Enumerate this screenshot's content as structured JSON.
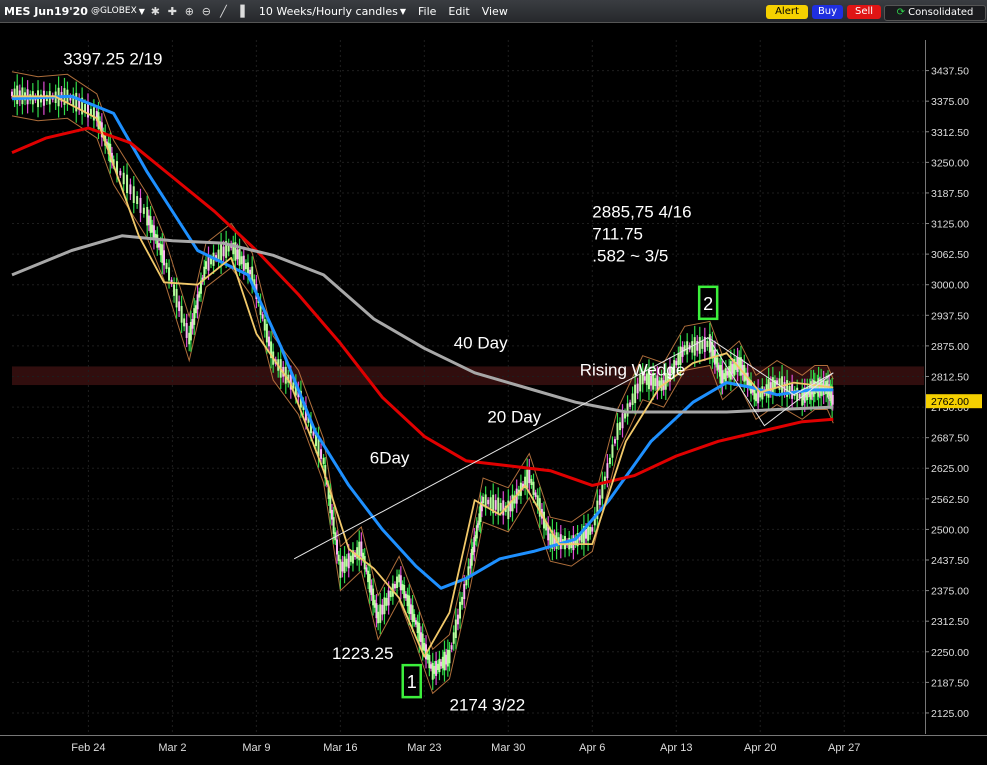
{
  "toolbar": {
    "symbol": "MES Jun19'20",
    "exchange": "@GLOBEX",
    "timeframe": "10 Weeks/Hourly candles",
    "menu_file": "File",
    "menu_edit": "Edit",
    "menu_view": "View",
    "alert": "Alert",
    "buy": "Buy",
    "sell": "Sell",
    "consolidated": "Consolidated"
  },
  "chart_data": {
    "type": "line",
    "yticks": [
      3437.5,
      3375,
      3312.5,
      3250,
      3187.5,
      3125,
      3062.5,
      3000,
      2937.5,
      2875,
      2812.5,
      2750,
      2687.5,
      2625,
      2562.5,
      2500,
      2437.5,
      2375,
      2312.5,
      2250,
      2187.5,
      2125
    ],
    "ytick_labels": [
      "3437.50",
      "3375.00",
      "3312.50",
      "3250.00",
      "3187.50",
      "3125.00",
      "3062.50",
      "3000.00",
      "2937.50",
      "2875.00",
      "2812.50",
      "2750.00",
      "2687.50",
      "2625.00",
      "2562.50",
      "2500.00",
      "2437.50",
      "2375.00",
      "2312.50",
      "2250.00",
      "2187.50",
      "2125.00"
    ],
    "ylim": [
      2082,
      3500
    ],
    "xlabels": [
      "Feb 24",
      "Mar 2",
      "Mar 9",
      "Mar 16",
      "Mar 23",
      "Mar 30",
      "Apr 6",
      "Apr 13",
      "Apr 20",
      "Apr 27"
    ],
    "xpos": [
      1,
      2,
      3,
      4,
      5,
      6,
      7,
      8,
      9,
      10
    ],
    "xlim": [
      0.09,
      10.95
    ],
    "last_price": "2762.00",
    "zone": [
      2795,
      2833
    ],
    "price": {
      "x": [
        0.09,
        0.4,
        0.75,
        1.1,
        1.3,
        1.7,
        1.9,
        2.2,
        2.4,
        2.7,
        2.95,
        3.2,
        3.5,
        3.8,
        4.0,
        4.25,
        4.45,
        4.7,
        4.9,
        5.1,
        5.3,
        5.55,
        5.7,
        6.0,
        6.25,
        6.5,
        6.75,
        7.0,
        7.3,
        7.6,
        7.85,
        8.1,
        8.4,
        8.55,
        8.75,
        8.95,
        9.2,
        9.5,
        9.65,
        9.8,
        9.87
      ],
      "y": [
        3390,
        3380,
        3385,
        3345,
        3250,
        3140,
        3055,
        2890,
        3040,
        3080,
        3020,
        2850,
        2780,
        2640,
        2420,
        2460,
        2320,
        2400,
        2310,
        2210,
        2240,
        2430,
        2560,
        2540,
        2610,
        2480,
        2470,
        2500,
        2700,
        2810,
        2795,
        2870,
        2880,
        2810,
        2840,
        2770,
        2800,
        2770,
        2790,
        2790,
        2762
      ]
    },
    "series": [
      {
        "name": "6Day",
        "color": "#1e90ff",
        "x": [
          0.09,
          0.8,
          1.3,
          1.7,
          2.3,
          2.9,
          3.3,
          3.7,
          4.1,
          4.5,
          4.9,
          5.2,
          5.5,
          5.9,
          6.3,
          6.8,
          7.2,
          7.7,
          8.2,
          8.6,
          8.9,
          9.2,
          9.6,
          9.87
        ],
        "y": [
          3380,
          3385,
          3350,
          3230,
          3070,
          3020,
          2870,
          2700,
          2590,
          2500,
          2425,
          2380,
          2400,
          2440,
          2455,
          2480,
          2560,
          2680,
          2760,
          2800,
          2790,
          2775,
          2785,
          2785
        ]
      },
      {
        "name": "20 Day",
        "color": "#e00000",
        "x": [
          0.09,
          0.5,
          1.0,
          1.5,
          2.0,
          2.5,
          3.0,
          3.5,
          4.0,
          4.5,
          5.0,
          5.5,
          6.0,
          6.5,
          7.0,
          7.5,
          8.0,
          8.5,
          9.0,
          9.5,
          9.87
        ],
        "y": [
          3270,
          3300,
          3320,
          3290,
          3220,
          3150,
          3070,
          2980,
          2880,
          2770,
          2690,
          2640,
          2630,
          2620,
          2590,
          2610,
          2650,
          2680,
          2700,
          2720,
          2725
        ]
      },
      {
        "name": "40 Day",
        "color": "#a8a8a8",
        "x": [
          0.09,
          0.8,
          1.4,
          2.0,
          2.6,
          3.2,
          3.8,
          4.4,
          5.0,
          5.6,
          6.2,
          6.8,
          7.4,
          8.0,
          8.6,
          9.2,
          9.87
        ],
        "y": [
          3020,
          3070,
          3100,
          3090,
          3085,
          3060,
          3020,
          2930,
          2870,
          2820,
          2790,
          2760,
          2740,
          2740,
          2740,
          2745,
          2750
        ]
      },
      {
        "name": "",
        "color": "#f2c96a",
        "x": [
          0.09,
          0.6,
          1.1,
          1.6,
          1.9,
          2.3,
          2.7,
          3.0,
          3.4,
          3.8,
          4.1,
          4.4,
          4.7,
          5.0,
          5.3,
          5.6,
          5.9,
          6.2,
          6.6,
          7.0,
          7.4,
          7.8,
          8.2,
          8.6,
          9.0,
          9.4,
          9.87
        ],
        "y": [
          3385,
          3385,
          3340,
          3100,
          3005,
          3000,
          3055,
          2900,
          2800,
          2620,
          2460,
          2420,
          2360,
          2240,
          2330,
          2560,
          2530,
          2590,
          2470,
          2470,
          2680,
          2790,
          2840,
          2860,
          2780,
          2800,
          2790
        ]
      }
    ],
    "wedge": {
      "x": [
        8.38,
        9.05,
        9.87,
        9.4,
        8.38
      ],
      "y": [
        2892,
        2712,
        2820,
        2775,
        2892
      ]
    },
    "rising_line": {
      "x": [
        3.45,
        8.38
      ],
      "y": [
        2440,
        2892
      ]
    },
    "annotations": [
      {
        "text": "3397.25 2/19",
        "x": 0.7,
        "y": 3450
      },
      {
        "text": "2885,75 4/16",
        "x": 7.0,
        "y": 3137
      },
      {
        "text": "711.75",
        "x": 7.0,
        "y": 3092
      },
      {
        "text": ".582 ~ 3/5",
        "x": 7.0,
        "y": 3047
      },
      {
        "text": "40 Day",
        "x": 5.35,
        "y": 2870
      },
      {
        "text": "Rising Wedge",
        "x": 6.85,
        "y": 2815
      },
      {
        "text": "20 Day",
        "x": 5.75,
        "y": 2718
      },
      {
        "text": "6Day",
        "x": 4.35,
        "y": 2635
      },
      {
        "text": "1223.25",
        "x": 3.9,
        "y": 2235
      },
      {
        "text": "2174  3/22",
        "x": 5.3,
        "y": 2130
      }
    ],
    "waves": [
      {
        "label": "1",
        "x": 4.85,
        "y": 2190
      },
      {
        "label": "2",
        "x": 8.38,
        "y": 2963
      }
    ]
  }
}
